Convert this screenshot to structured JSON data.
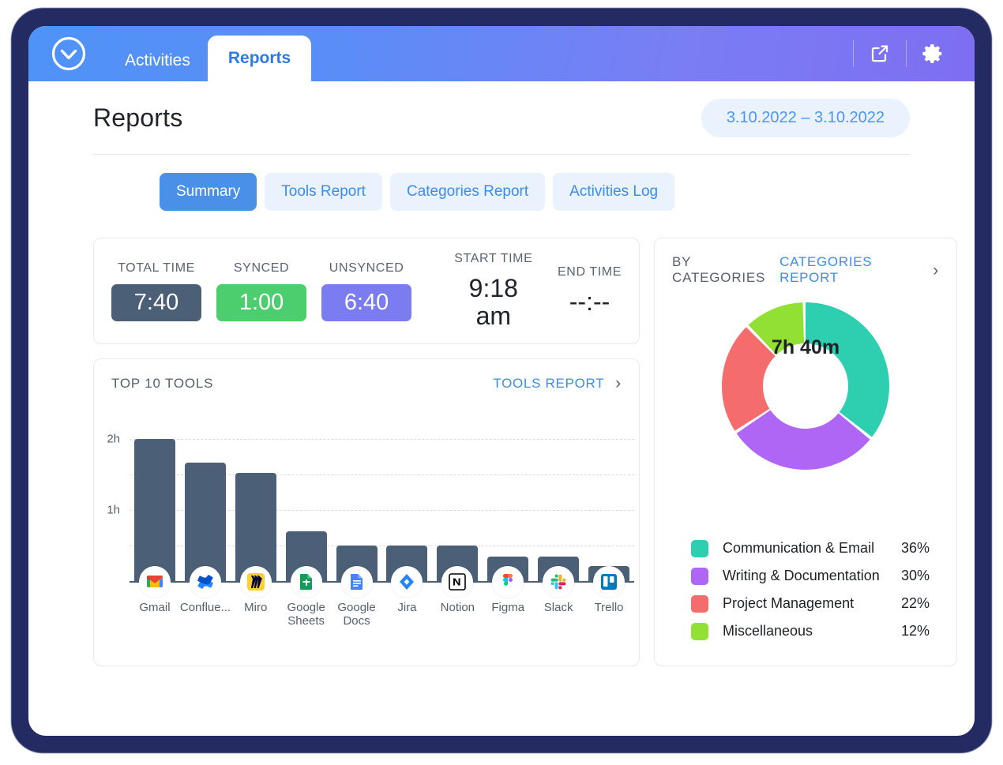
{
  "header": {
    "logo_icon": "clock-logo-icon",
    "tabs": [
      {
        "label": "Activities",
        "active": false
      },
      {
        "label": "Reports",
        "active": true
      }
    ],
    "actions": [
      {
        "name": "export-icon",
        "label": "Export"
      },
      {
        "name": "gear-icon",
        "label": "Settings"
      }
    ]
  },
  "page": {
    "title": "Reports",
    "date_range": "3.10.2022 – 3.10.2022"
  },
  "report_tabs": [
    {
      "label": "Summary",
      "active": true
    },
    {
      "label": "Tools Report",
      "active": false
    },
    {
      "label": "Categories Report",
      "active": false
    },
    {
      "label": "Activities Log",
      "active": false
    }
  ],
  "stats": {
    "total": {
      "label": "TOTAL TIME",
      "value": "7:40",
      "color": "#4b6076"
    },
    "synced": {
      "label": "SYNCED",
      "value": "1:00",
      "color": "#4cce6f"
    },
    "unsynced": {
      "label": "UNSYNCED",
      "value": "6:40",
      "color": "#7b7cf0"
    },
    "start": {
      "label": "START  TIME",
      "value": "9:18 am"
    },
    "end": {
      "label": "END TIME",
      "value": "--:--"
    }
  },
  "tools_card": {
    "title": "TOP 10 TOOLS",
    "link": "TOOLS REPORT",
    "chevron": "›"
  },
  "categories_card": {
    "title": "BY CATEGORIES",
    "link": "CATEGORIES REPORT",
    "chevron": "›",
    "center_total": "7h 40m"
  },
  "chart_data": [
    {
      "type": "bar",
      "title": "TOP 10 TOOLS",
      "xlabel": "",
      "ylabel": "",
      "ylim": [
        0,
        2.2
      ],
      "grid": true,
      "ytick_labels": [
        "1h",
        "2h"
      ],
      "ytick_values": [
        1,
        2
      ],
      "gridline_values": [
        0.5,
        1,
        1.5,
        2
      ],
      "bar_color": "#4b6076",
      "categories": [
        "Gmail",
        "Conflue...",
        "Miro",
        "Google Sheets",
        "Google Docs",
        "Jira",
        "Notion",
        "Figma",
        "Slack",
        "Trello"
      ],
      "icons": [
        "gmail-icon",
        "confluence-icon",
        "miro-icon",
        "google-sheets-icon",
        "google-docs-icon",
        "jira-icon",
        "notion-icon",
        "figma-icon",
        "slack-icon",
        "trello-icon"
      ],
      "values": [
        2.0,
        1.67,
        1.52,
        0.7,
        0.5,
        0.5,
        0.5,
        0.34,
        0.34,
        0.21
      ]
    },
    {
      "type": "pie",
      "title": "BY CATEGORIES",
      "center_label": "7h 40m",
      "legend_position": "bottom",
      "labels": [
        "Communication & Email",
        "Writing & Documentation",
        "Project Management",
        "Miscellaneous"
      ],
      "values": [
        36,
        30,
        22,
        12
      ],
      "value_labels": [
        "36%",
        "30%",
        "22%",
        "12%"
      ],
      "colors": [
        "#2ecfb0",
        "#b066f5",
        "#f56c6c",
        "#93e034"
      ]
    }
  ]
}
